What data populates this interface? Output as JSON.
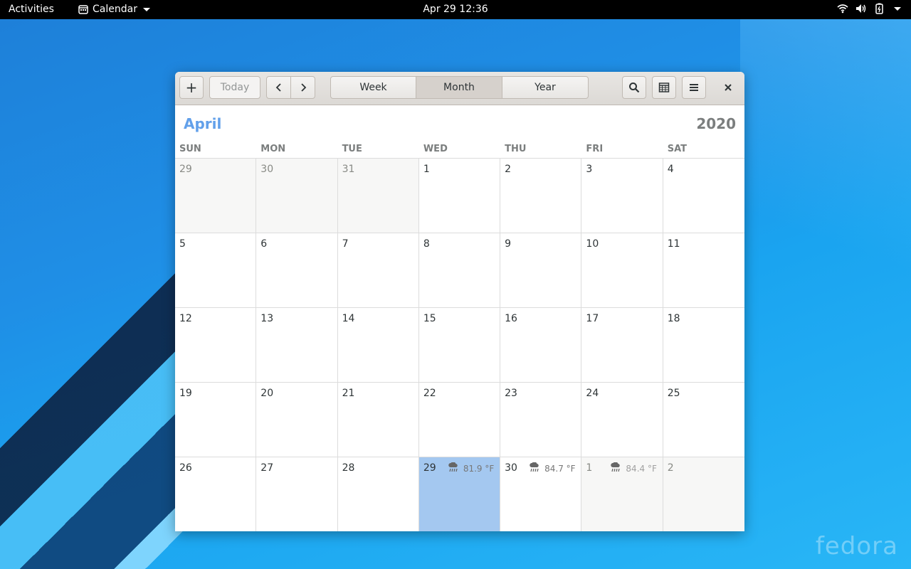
{
  "topbar": {
    "activities": "Activities",
    "app_name": "Calendar",
    "clock": "Apr 29  12:36"
  },
  "wallpaper": {
    "brand": "fedora"
  },
  "headerbar": {
    "today_label": "Today",
    "views": [
      "Week",
      "Month",
      "Year"
    ],
    "active_view": "Month"
  },
  "calendar": {
    "month": "April",
    "year": "2020",
    "weekdays": [
      "SUN",
      "MON",
      "TUE",
      "WED",
      "THU",
      "FRI",
      "SAT"
    ],
    "days": [
      {
        "n": "29",
        "other": true
      },
      {
        "n": "30",
        "other": true
      },
      {
        "n": "31",
        "other": true
      },
      {
        "n": "1"
      },
      {
        "n": "2"
      },
      {
        "n": "3"
      },
      {
        "n": "4"
      },
      {
        "n": "5"
      },
      {
        "n": "6"
      },
      {
        "n": "7"
      },
      {
        "n": "8"
      },
      {
        "n": "9"
      },
      {
        "n": "10"
      },
      {
        "n": "11"
      },
      {
        "n": "12"
      },
      {
        "n": "13"
      },
      {
        "n": "14"
      },
      {
        "n": "15"
      },
      {
        "n": "16"
      },
      {
        "n": "17"
      },
      {
        "n": "18"
      },
      {
        "n": "19"
      },
      {
        "n": "20"
      },
      {
        "n": "21"
      },
      {
        "n": "22"
      },
      {
        "n": "23"
      },
      {
        "n": "24"
      },
      {
        "n": "25"
      },
      {
        "n": "26"
      },
      {
        "n": "27"
      },
      {
        "n": "28"
      },
      {
        "n": "29",
        "today": true,
        "weather": "81.9 °F"
      },
      {
        "n": "30",
        "weather": "84.7 °F"
      },
      {
        "n": "1",
        "other": true,
        "weather": "84.4 °F"
      },
      {
        "n": "2",
        "other": true
      }
    ]
  },
  "colors": {
    "accent": "#62a0ea",
    "today_bg": "#a4c8f0"
  }
}
